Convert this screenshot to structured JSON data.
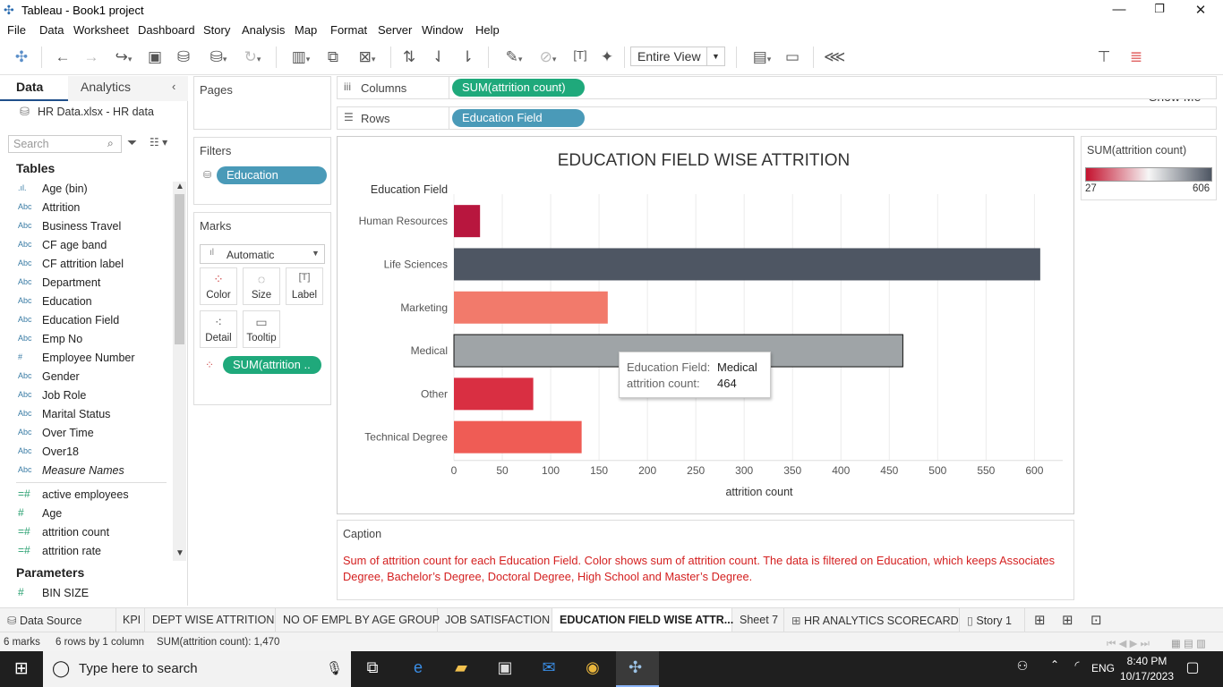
{
  "window": {
    "title": "Tableau - Book1 project",
    "minimize": "—",
    "restore": "❐",
    "close": "✕"
  },
  "menu": [
    "File",
    "Data",
    "Worksheet",
    "Dashboard",
    "Story",
    "Analysis",
    "Map",
    "Format",
    "Server",
    "Window",
    "Help"
  ],
  "toolbar": {
    "view_mode": "Entire View",
    "show_me": "Show Me"
  },
  "data_pane": {
    "tabs": [
      "Data",
      "Analytics"
    ],
    "source": "HR Data.xlsx - HR data",
    "search_placeholder": "Search",
    "tables_header": "Tables",
    "dimensions": [
      {
        "icon": ".ıl.",
        "name": "Age (bin)"
      },
      {
        "icon": "Abc",
        "name": "Attrition"
      },
      {
        "icon": "Abc",
        "name": "Business Travel"
      },
      {
        "icon": "Abc",
        "name": "CF age band"
      },
      {
        "icon": "Abc",
        "name": "CF attrition label"
      },
      {
        "icon": "Abc",
        "name": "Department"
      },
      {
        "icon": "Abc",
        "name": "Education"
      },
      {
        "icon": "Abc",
        "name": "Education Field"
      },
      {
        "icon": "Abc",
        "name": "Emp No"
      },
      {
        "icon": "#",
        "name": "Employee Number"
      },
      {
        "icon": "Abc",
        "name": "Gender"
      },
      {
        "icon": "Abc",
        "name": "Job Role"
      },
      {
        "icon": "Abc",
        "name": "Marital Status"
      },
      {
        "icon": "Abc",
        "name": "Over Time"
      },
      {
        "icon": "Abc",
        "name": "Over18"
      },
      {
        "icon": "Abc",
        "name": "Measure Names"
      }
    ],
    "measures": [
      {
        "icon": "=#",
        "name": "active employees"
      },
      {
        "icon": "#",
        "name": "Age"
      },
      {
        "icon": "=#",
        "name": "attrition count"
      },
      {
        "icon": "=#",
        "name": "attrition rate"
      }
    ],
    "parameters_header": "Parameters",
    "parameters": [
      {
        "icon": "#",
        "name": "BIN SIZE"
      }
    ]
  },
  "shelves": {
    "pages_label": "Pages",
    "filters_label": "Filters",
    "filter_pill": "Education",
    "marks_label": "Marks",
    "mark_type": "Automatic",
    "mark_buttons": [
      "Color",
      "Size",
      "Label",
      "Detail",
      "Tooltip"
    ],
    "marks_pill": "SUM(attrition ..",
    "columns_label": "Columns",
    "columns_pill": "SUM(attrition count)",
    "rows_label": "Rows",
    "rows_pill": "Education Field"
  },
  "chart_data": {
    "type": "bar",
    "orientation": "horizontal",
    "title": "EDUCATION FIELD WISE ATTRITION",
    "row_header": "Education Field",
    "xlabel": "attrition count",
    "categories": [
      "Human Resources",
      "Life Sciences",
      "Marketing",
      "Medical",
      "Other",
      "Technical Degree"
    ],
    "values": [
      27,
      606,
      159,
      464,
      82,
      132
    ],
    "colors": [
      "#b8163e",
      "#4e5663",
      "#f27a6b",
      "#9fa4a7",
      "#d92f42",
      "#ef5c55"
    ],
    "xlim": [
      0,
      620
    ],
    "xticks": [
      "0",
      "50",
      "100",
      "150",
      "200",
      "250",
      "300",
      "350",
      "400",
      "450",
      "500",
      "550",
      "600"
    ],
    "xtick_values": [
      0,
      50,
      100,
      150,
      200,
      250,
      300,
      350,
      400,
      450,
      500,
      550,
      600
    ],
    "highlighted": "Medical",
    "grid": true
  },
  "tooltip": {
    "field_label": "Education Field:",
    "field_value": "Medical",
    "measure_label": "attrition count:",
    "measure_value": "464"
  },
  "legend": {
    "title": "SUM(attrition count)",
    "min": "27",
    "max": "606",
    "low_color": "#c4122e",
    "high_color": "#4e5663"
  },
  "caption": {
    "header": "Caption",
    "text": "Sum of attrition count for each Education Field.  Color shows sum of attrition count. The data is filtered on Education, which keeps Associates Degree, Bachelor’s Degree, Doctoral Degree, High School and Master’s Degree."
  },
  "sheet_tabs": [
    "Data Source",
    "KPI",
    "DEPT WISE ATTRITION",
    "NO OF EMPL BY AGE GROUP",
    "JOB SATISFACTION",
    "EDUCATION FIELD WISE ATTR...",
    "Sheet 7",
    "HR ANALYTICS SCORECARD",
    "Story 1"
  ],
  "status": {
    "marks": "6 marks",
    "rows": "6 rows by 1 column",
    "sum": "SUM(attrition count): 1,470"
  },
  "taskbar": {
    "search_placeholder": "Type here to search",
    "language": "ENG",
    "time": "8:40 PM",
    "date": "10/17/2023"
  }
}
